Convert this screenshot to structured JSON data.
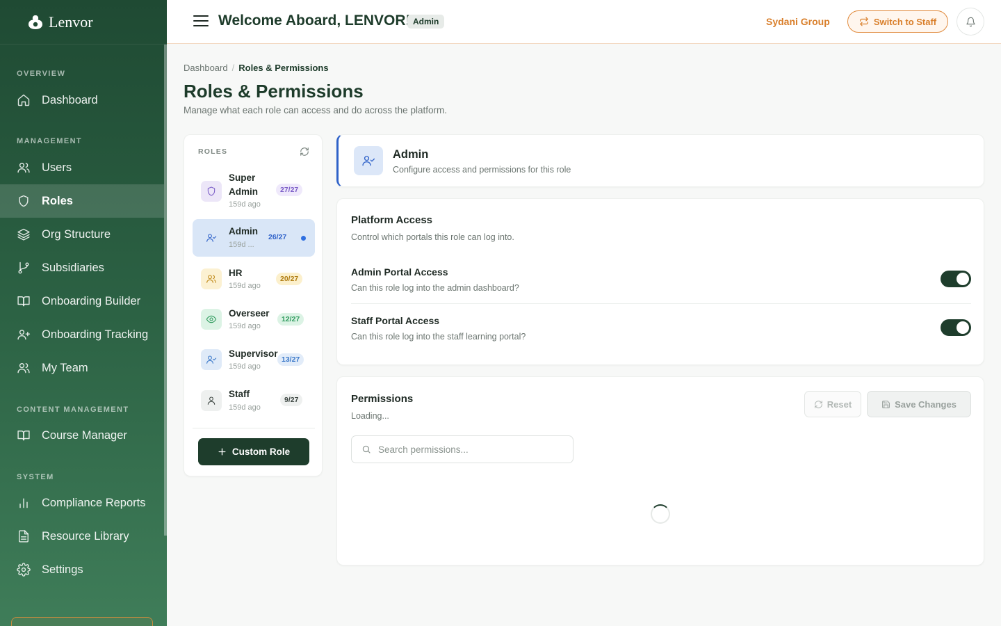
{
  "sidebar": {
    "brand": "Lenvor",
    "sections": {
      "overview": "OVERVIEW",
      "management": "MANAGEMENT",
      "content": "CONTENT MANAGEMENT",
      "system": "SYSTEM"
    },
    "items": {
      "dashboard": "Dashboard",
      "users": "Users",
      "roles": "Roles",
      "org_structure": "Org Structure",
      "subsidiaries": "Subsidiaries",
      "onboarding_builder": "Onboarding Builder",
      "onboarding_tracking": "Onboarding Tracking",
      "my_team": "My Team",
      "course_manager": "Course Manager",
      "compliance_reports": "Compliance Reports",
      "resource_library": "Resource Library",
      "settings": "Settings"
    },
    "active": "roles"
  },
  "header": {
    "welcome": "Welcome Aboard, LENVOR!",
    "role_badge": "Admin",
    "org_name": "Sydani Group",
    "switch_label": "Switch to Staff"
  },
  "breadcrumb": {
    "root": "Dashboard",
    "current": "Roles & Permissions"
  },
  "page": {
    "title": "Roles & Permissions",
    "subtitle": "Manage what each role can access and do across the platform."
  },
  "roles_panel": {
    "heading": "ROLES",
    "roles": [
      {
        "name_line1": "Super",
        "name_line2": "Admin",
        "date": "159d ago",
        "count": "27/27",
        "icon": "shield-icon"
      },
      {
        "name": "Admin",
        "date": "159d ...",
        "count": "26/27",
        "icon": "user-check-icon",
        "selected": true
      },
      {
        "name": "HR",
        "date": "159d ago",
        "count": "20/27",
        "icon": "users-icon"
      },
      {
        "name": "Overseer",
        "date": "159d ago",
        "count": "12/27",
        "icon": "eye-icon"
      },
      {
        "name": "Supervisor",
        "date": "159d ago",
        "count": "13/27",
        "icon": "user-check-icon"
      },
      {
        "name": "Staff",
        "date": "159d ago",
        "count": "9/27",
        "icon": "user-icon"
      }
    ],
    "custom_role_label": "Custom Role"
  },
  "selected_role": {
    "title": "Admin",
    "subtitle": "Configure access and permissions for this role"
  },
  "platform_access": {
    "title": "Platform Access",
    "subtitle": "Control which portals this role can log into.",
    "admin_portal": {
      "label": "Admin Portal Access",
      "desc": "Can this role log into the admin dashboard?",
      "enabled": true
    },
    "staff_portal": {
      "label": "Staff Portal Access",
      "desc": "Can this role log into the staff learning portal?",
      "enabled": true
    }
  },
  "permissions": {
    "title": "Permissions",
    "status": "Loading...",
    "reset_label": "Reset",
    "save_label": "Save Changes",
    "search_placeholder": "Search permissions..."
  },
  "colors": {
    "sidebar_top": "#1f4a33",
    "accent_dark": "#1e3d2c",
    "orange": "#d97f2b",
    "selected_blue": "#d9e6f7"
  }
}
